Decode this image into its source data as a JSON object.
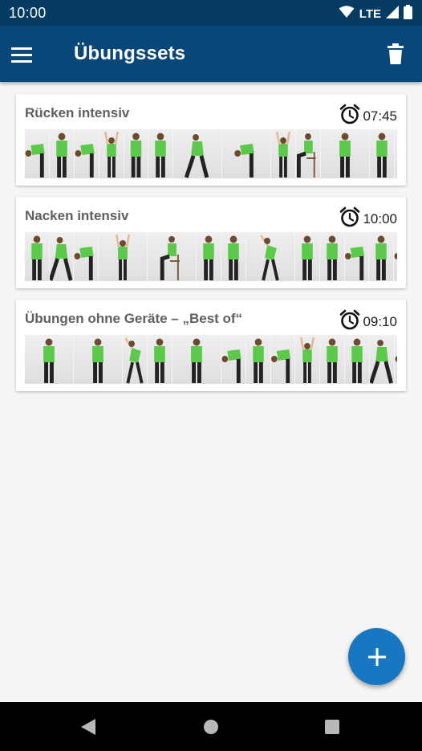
{
  "status_bar": {
    "time": "10:00",
    "network": "LTE",
    "icons": [
      "wifi-icon",
      "signal-icon",
      "battery-icon"
    ]
  },
  "app_bar": {
    "title": "Übungssets",
    "menu_icon": "hamburger-menu-icon",
    "action_icon": "trash-icon"
  },
  "exercise_sets": [
    {
      "name": "Rücken intensiv",
      "duration": "07:45",
      "thumb_count": 15
    },
    {
      "name": "Nacken intensiv",
      "duration": "10:00",
      "thumb_count": 15
    },
    {
      "name": "Übungen ohne Geräte – „Best of“",
      "duration": "09:10",
      "thumb_count": 15
    }
  ],
  "fab": {
    "icon": "plus-icon"
  },
  "nav_bar": {
    "icons": [
      "back-icon",
      "home-icon",
      "recents-icon"
    ]
  },
  "colors": {
    "status_bar": "#063c63",
    "app_bar": "#084777",
    "fab": "#1877c2",
    "shirt": "#5cc94c",
    "background": "#f5f5f5"
  }
}
